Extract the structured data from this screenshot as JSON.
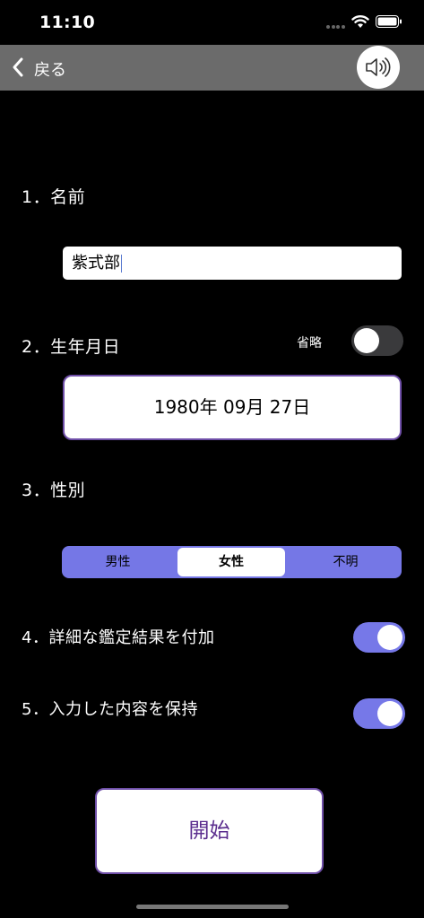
{
  "status_bar": {
    "time": "11:10"
  },
  "nav": {
    "back_label": "戻る"
  },
  "sections": {
    "name": {
      "label": "1．名前",
      "value": "紫式部"
    },
    "birthday": {
      "label": "2．生年月日",
      "omit_label": "省略",
      "omit_on": false,
      "date": "1980年 09月 27日"
    },
    "gender": {
      "label": "3．性別",
      "options": [
        "男性",
        "女性",
        "不明"
      ],
      "selected": "女性"
    },
    "detailed_result": {
      "label": "4．詳細な鑑定結果を付加",
      "on": true
    },
    "keep_input": {
      "label": "5．入力した内容を保持",
      "on": true
    }
  },
  "start_button": {
    "label": "開始"
  },
  "colors": {
    "accent": "#7577e6",
    "button_border": "#6f4fa8",
    "button_text": "#5b2d8e",
    "navbar": "#6b6b6b"
  }
}
